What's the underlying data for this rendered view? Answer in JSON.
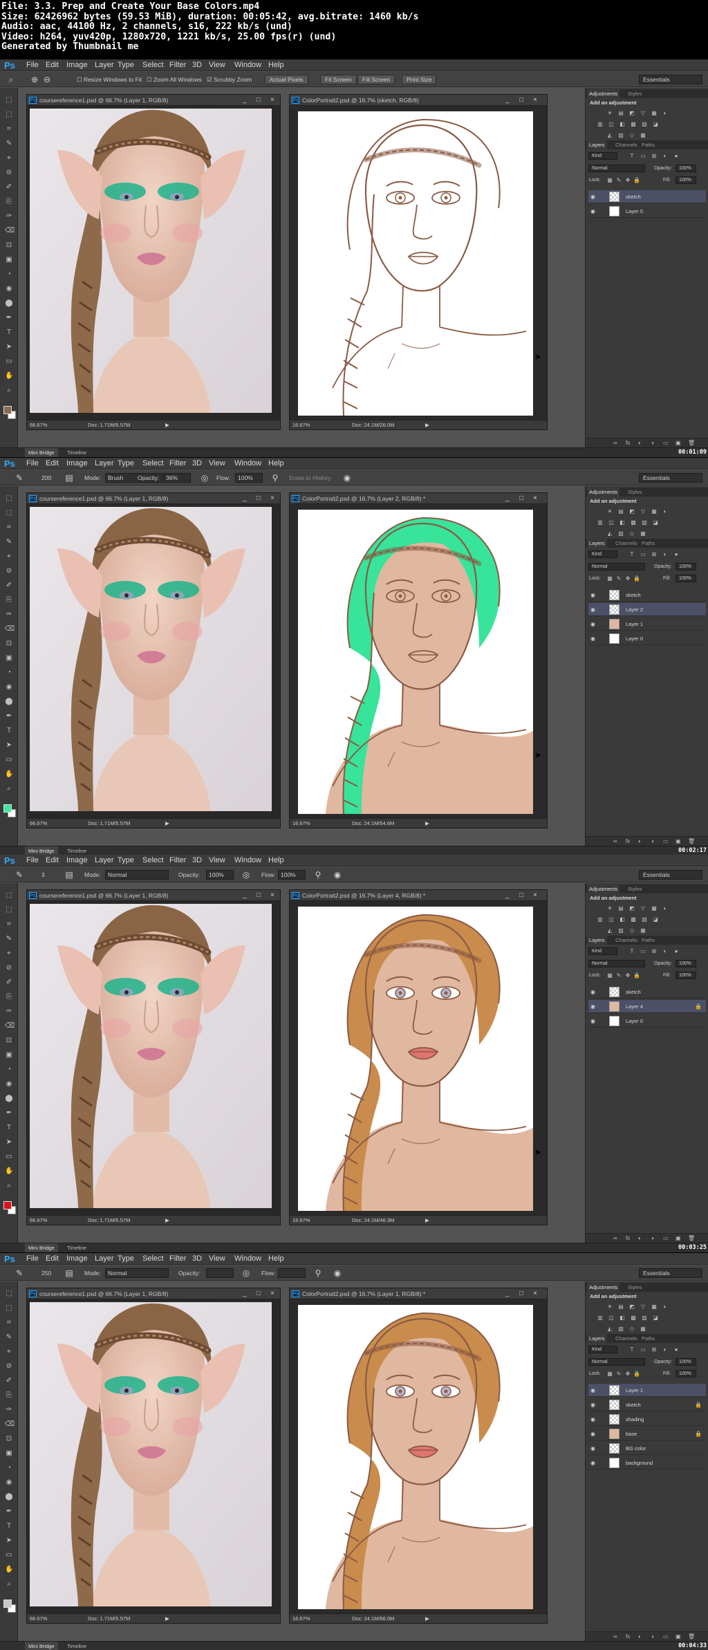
{
  "header": {
    "lines": [
      "File: 3.3. Prep and Create Your Base Colors.mp4",
      "Size: 62426962 bytes (59.53 MiB), duration: 00:05:42, avg.bitrate: 1460 kb/s",
      "Audio: aac, 44100 Hz, 2 channels, s16, 222 kb/s (und)",
      "Video: h264, yuv420p, 1280x720, 1221 kb/s, 25.00 fps(r) (und)",
      "Generated by Thumbnail me"
    ]
  },
  "app": {
    "logo": "Ps",
    "menu": [
      "File",
      "Edit",
      "Image",
      "Layer",
      "Type",
      "Select",
      "Filter",
      "3D",
      "View",
      "Window",
      "Help"
    ],
    "workspace": "Essentials",
    "bottom_tabs": [
      "Mini Bridge",
      "Timeline"
    ],
    "win_ctrls": [
      "_",
      "□",
      "×"
    ]
  },
  "panels": {
    "top_tabs": [
      "Adjustments",
      "Styles"
    ],
    "add_adjustment": "Add an adjustment",
    "layers_tabs": [
      "Layers",
      "Channels",
      "Paths"
    ],
    "kind": "Kind",
    "blend": "Normal",
    "opacity_label": "Opacity:",
    "fill_label": "Fill:",
    "lock_label": "Lock:",
    "percent": "100%"
  },
  "frames": [
    {
      "timestamp": "00:01:09",
      "options": {
        "tool": "zoom",
        "items": [
          "Resize Windows to Fit",
          "Zoom All Windows",
          "Scrubby Zoom"
        ],
        "buttons": [
          "Actual Pixels",
          "Fit Screen",
          "Fill Screen",
          "Print Size"
        ]
      },
      "ref_window": {
        "title": "coursereference1.psd @ 66.7% (Layer 1, RGB/8)",
        "zoom": "66.67%",
        "doc": "Doc: 1.71M/5.57M"
      },
      "art_window": {
        "title": "ColorPortrait2.psd @ 16.7% (sketch, RGB/8)",
        "zoom": "16.67%",
        "doc": "Doc: 24.1M/26.0M"
      },
      "stage": "sketch",
      "fg_color": "#8a6a55",
      "layers": [
        {
          "name": "sketch",
          "thumb": "trans",
          "selected": true,
          "lock": false
        },
        {
          "name": "Layer 0",
          "thumb": "white",
          "selected": false,
          "lock": false
        }
      ]
    },
    {
      "timestamp": "00:02:17",
      "options": {
        "tool": "brush",
        "size": "200",
        "mode_label": "Mode:",
        "mode": "Brush",
        "opacity_label": "Opacity:",
        "opacity": "36%",
        "flow_label": "Flow:",
        "flow": "100%",
        "extra": "Erase to History"
      },
      "ref_window": {
        "title": "coursereference1.psd @ 66.7% (Layer 1, RGB/8)",
        "zoom": "66.67%",
        "doc": "Doc: 1.71M/5.57M"
      },
      "art_window": {
        "title": "ColorPortrait2.psd @ 16.7% (Layer 2, RGB/8) *",
        "zoom": "16.67%",
        "doc": "Doc: 24.1M/54.6M"
      },
      "stage": "green",
      "fg_color": "#3de8a0",
      "layers": [
        {
          "name": "sketch",
          "thumb": "trans",
          "selected": false,
          "lock": false
        },
        {
          "name": "Layer 2",
          "thumb": "trans",
          "selected": true,
          "lock": false
        },
        {
          "name": "Layer 1",
          "thumb": "skin",
          "selected": false,
          "lock": false
        },
        {
          "name": "Layer 0",
          "thumb": "white",
          "selected": false,
          "lock": false
        }
      ]
    },
    {
      "timestamp": "00:03:25",
      "options": {
        "tool": "brush",
        "size": "3",
        "mode_label": "Mode:",
        "mode": "Normal",
        "opacity_label": "Opacity:",
        "opacity": "100%",
        "flow_label": "Flow:",
        "flow": "100%",
        "extra": ""
      },
      "ref_window": {
        "title": "coursereference1.psd @ 66.7% (Layer 1, RGB/8)",
        "zoom": "66.67%",
        "doc": "Doc: 1.71M/5.57M"
      },
      "art_window": {
        "title": "ColorPortrait2.psd @ 16.7% (Layer 4, RGB/8) *",
        "zoom": "16.67%",
        "doc": "Doc: 24.1M/46.3M"
      },
      "stage": "color",
      "fg_color": "#e0101a",
      "layers": [
        {
          "name": "sketch",
          "thumb": "trans",
          "selected": false,
          "lock": false
        },
        {
          "name": "Layer 4",
          "thumb": "skin",
          "selected": true,
          "lock": true
        },
        {
          "name": "Layer 0",
          "thumb": "white",
          "selected": false,
          "lock": false
        }
      ]
    },
    {
      "timestamp": "00:04:33",
      "options": {
        "tool": "brush",
        "size": "250",
        "mode_label": "Mode:",
        "mode": "Normal",
        "opacity_label": "Opacity:",
        "opacity": "",
        "flow_label": "Flow:",
        "flow": "",
        "extra": ""
      },
      "ref_window": {
        "title": "coursereference1.psd @ 66.7% (Layer 1, RGB/8)",
        "zoom": "66.67%",
        "doc": "Doc: 1.71M/5.57M"
      },
      "art_window": {
        "title": "ColorPortrait2.psd @ 16.7% (Layer 1, RGB/8) *",
        "zoom": "16.67%",
        "doc": "Doc: 24.1M/66.0M"
      },
      "stage": "final",
      "fg_color": "#c8c8c8",
      "layers": [
        {
          "name": "Layer 1",
          "thumb": "trans",
          "selected": true,
          "lock": false
        },
        {
          "name": "sketch",
          "thumb": "trans",
          "selected": false,
          "lock": true
        },
        {
          "name": "shading",
          "thumb": "trans",
          "selected": false,
          "lock": false
        },
        {
          "name": "base",
          "thumb": "skin",
          "selected": false,
          "lock": true
        },
        {
          "name": "BG color",
          "thumb": "trans",
          "selected": false,
          "lock": false
        },
        {
          "name": "background",
          "thumb": "white",
          "selected": false,
          "lock": false
        }
      ]
    }
  ]
}
